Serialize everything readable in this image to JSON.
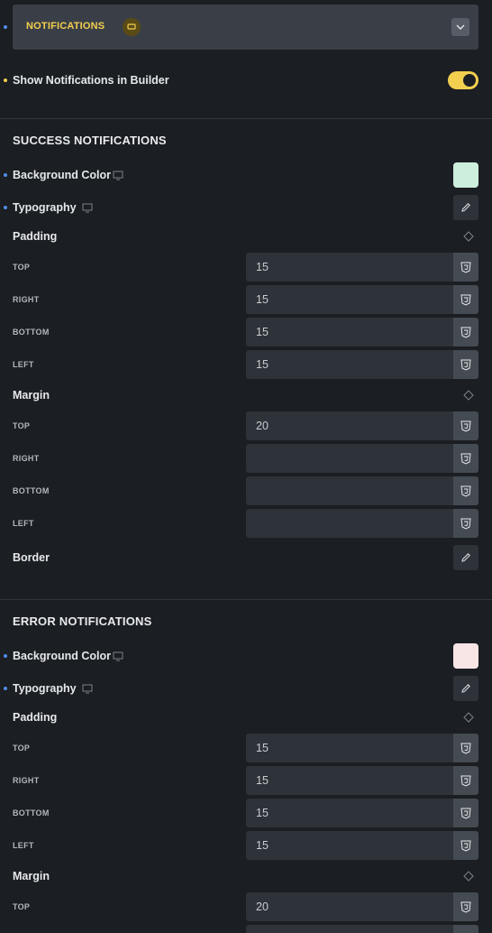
{
  "header": {
    "title": "NOTIFICATIONS"
  },
  "show_notifications": {
    "label": "Show Notifications in Builder",
    "enabled": true
  },
  "success": {
    "title": "SUCCESS NOTIFICATIONS",
    "background_label": "Background Color",
    "background_color": "#cdeedc",
    "typography_label": "Typography",
    "padding_label": "Padding",
    "padding": {
      "top_label": "TOP",
      "top": "15",
      "right_label": "RIGHT",
      "right": "15",
      "bottom_label": "BOTTOM",
      "bottom": "15",
      "left_label": "LEFT",
      "left": "15"
    },
    "margin_label": "Margin",
    "margin": {
      "top_label": "TOP",
      "top": "20",
      "right_label": "RIGHT",
      "right": "",
      "bottom_label": "BOTTOM",
      "bottom": "",
      "left_label": "LEFT",
      "left": ""
    },
    "border_label": "Border"
  },
  "error": {
    "title": "ERROR NOTIFICATIONS",
    "background_label": "Background Color",
    "background_color": "#f8e5e5",
    "typography_label": "Typography",
    "padding_label": "Padding",
    "padding": {
      "top_label": "TOP",
      "top": "15",
      "right_label": "RIGHT",
      "right": "15",
      "bottom_label": "BOTTOM",
      "bottom": "15",
      "left_label": "LEFT",
      "left": "15"
    },
    "margin_label": "Margin",
    "margin": {
      "top_label": "TOP",
      "top": "20"
    }
  },
  "colors": {
    "accent": "#f3cf4f",
    "dot": "#4f8df0",
    "panel": "#1b1e22",
    "field": "#2e333a"
  }
}
